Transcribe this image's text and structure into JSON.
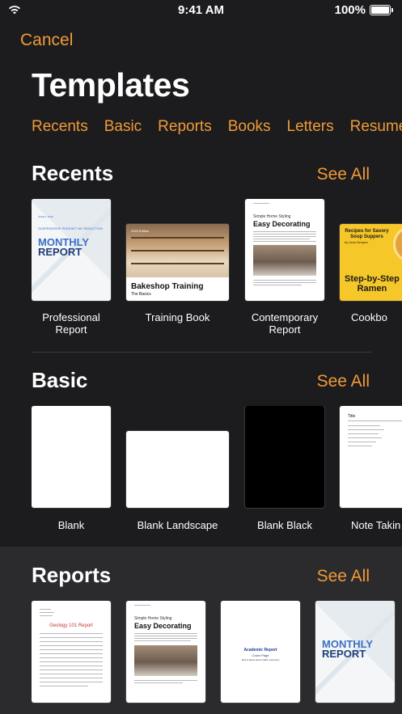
{
  "status_bar": {
    "time": "9:41 AM",
    "battery": "100%"
  },
  "nav": {
    "cancel": "Cancel",
    "title": "Templates"
  },
  "categories": [
    "Recents",
    "Basic",
    "Reports",
    "Books",
    "Letters",
    "Resumes"
  ],
  "accent_color": "#f09a37",
  "recents": {
    "title": "Recents",
    "see_all": "See All",
    "items": [
      {
        "label_line1": "Professional",
        "label_line2": "Report",
        "thumb": {
          "date": "JUNE 4, 2018",
          "kicker": "SUSPENDISSE PEDESET NE REDUCTION",
          "line1": "MONTHLY",
          "line2": "REPORT"
        }
      },
      {
        "label_line1": "Training Book",
        "label_line2": "",
        "thumb": {
          "edition": "2020 Edition",
          "title": "Bakeshop Training",
          "subtitle": "The Basics"
        }
      },
      {
        "label_line1": "Contemporary",
        "label_line2": "Report",
        "thumb": {
          "kicker": "Simple Home Styling",
          "title": "Easy Decorating"
        }
      },
      {
        "label_line1": "Cookbo",
        "label_line2": "",
        "thumb": {
          "header": "Recipes for Savory Soup Suppers",
          "author": "by Ursa Semper",
          "title_line1": "Step-by-Step",
          "title_line2": "Ramen"
        }
      }
    ]
  },
  "basic": {
    "title": "Basic",
    "see_all": "See All",
    "items": [
      {
        "label": "Blank"
      },
      {
        "label": "Blank Landscape"
      },
      {
        "label": "Blank Black"
      },
      {
        "label": "Note Takin",
        "thumb": {
          "title": "Title"
        }
      }
    ]
  },
  "reports": {
    "title": "Reports",
    "see_all": "See All",
    "items": [
      {
        "thumb": {
          "title": "Geology 101 Report"
        }
      },
      {
        "thumb": {
          "kicker": "Simple Home Styling",
          "title": "Easy Decorating"
        }
      },
      {
        "thumb": {
          "title_line1": "Academic Report",
          "title_line2": "Cover Page",
          "subtitle": "Sed ut lacus amet mattis nonummy"
        }
      },
      {
        "thumb": {
          "line1": "MONTHLY",
          "line2": "REPORT"
        }
      }
    ]
  }
}
